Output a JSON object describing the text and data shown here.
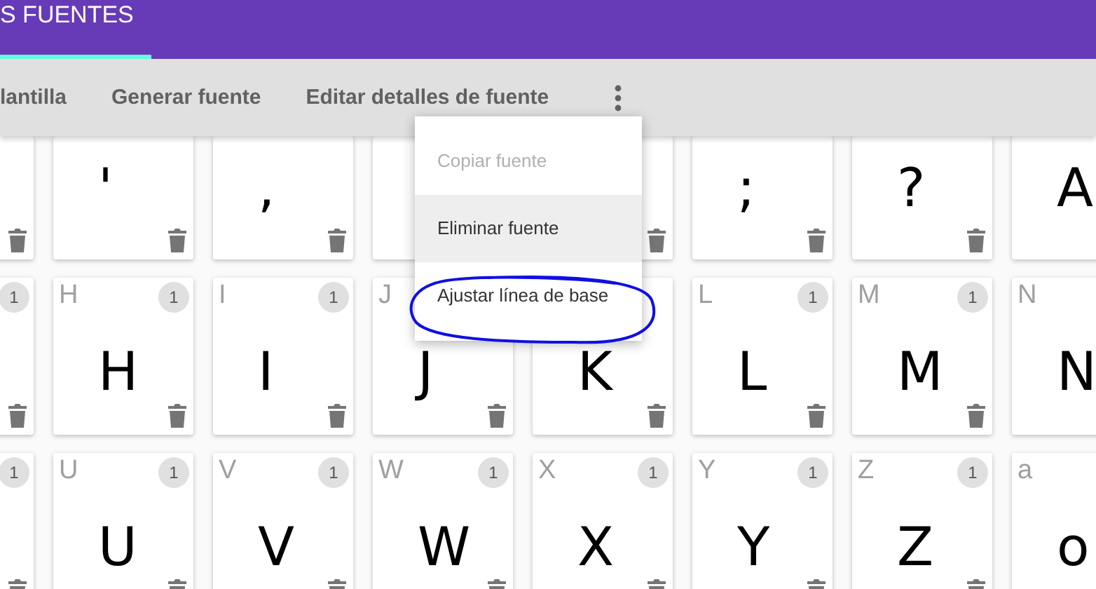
{
  "app_bar": {
    "title": "S FUENTES",
    "tab_selected": true
  },
  "toolbar": {
    "actions": [
      "lantilla",
      "Generar fuente",
      "Editar detalles de fuente"
    ]
  },
  "menu": {
    "items": [
      {
        "label": "Copiar fuente",
        "disabled": true,
        "selected": false,
        "circled": false
      },
      {
        "label": "Eliminar fuente",
        "disabled": false,
        "selected": true,
        "circled": false
      },
      {
        "label": "Ajustar línea de base",
        "disabled": false,
        "selected": false,
        "circled": true
      }
    ]
  },
  "glyph_rows": [
    [
      {},
      {
        "glyph": "'"
      },
      {
        "glyph": ","
      },
      {},
      {},
      {
        "glyph": ";"
      },
      {
        "glyph": "?"
      },
      {
        "glyph": "A"
      }
    ],
    [
      {
        "count": "1"
      },
      {
        "label": "H",
        "count": "1",
        "glyph": "H"
      },
      {
        "label": "I",
        "count": "1",
        "glyph": "I"
      },
      {
        "label": "J",
        "glyph": "J"
      },
      {
        "glyph": "K"
      },
      {
        "label": "L",
        "count": "1",
        "glyph": "L"
      },
      {
        "label": "M",
        "count": "1",
        "glyph": "M"
      },
      {
        "label": "N",
        "glyph": "N"
      }
    ],
    [
      {
        "count": "1"
      },
      {
        "label": "U",
        "count": "1",
        "glyph": "U"
      },
      {
        "label": "V",
        "count": "1",
        "glyph": "V"
      },
      {
        "label": "W",
        "count": "1",
        "glyph": "W"
      },
      {
        "label": "X",
        "count": "1",
        "glyph": "X"
      },
      {
        "label": "Y",
        "count": "1",
        "glyph": "Y"
      },
      {
        "label": "Z",
        "count": "1",
        "glyph": "Z"
      },
      {
        "label": "a",
        "glyph": "o"
      }
    ]
  ]
}
